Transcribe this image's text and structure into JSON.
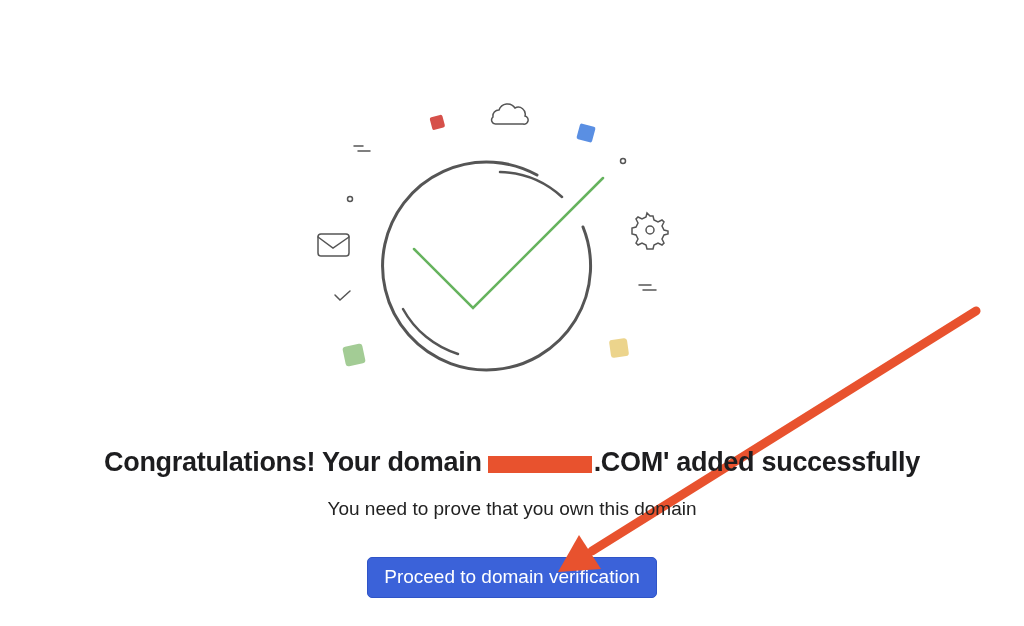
{
  "heading": {
    "before_redaction": "Congratulations! Your domain",
    "after_redaction": ".COM' added successfully"
  },
  "subtitle": "You need to prove that you own this domain",
  "button": {
    "label": "Proceed to domain verification"
  }
}
